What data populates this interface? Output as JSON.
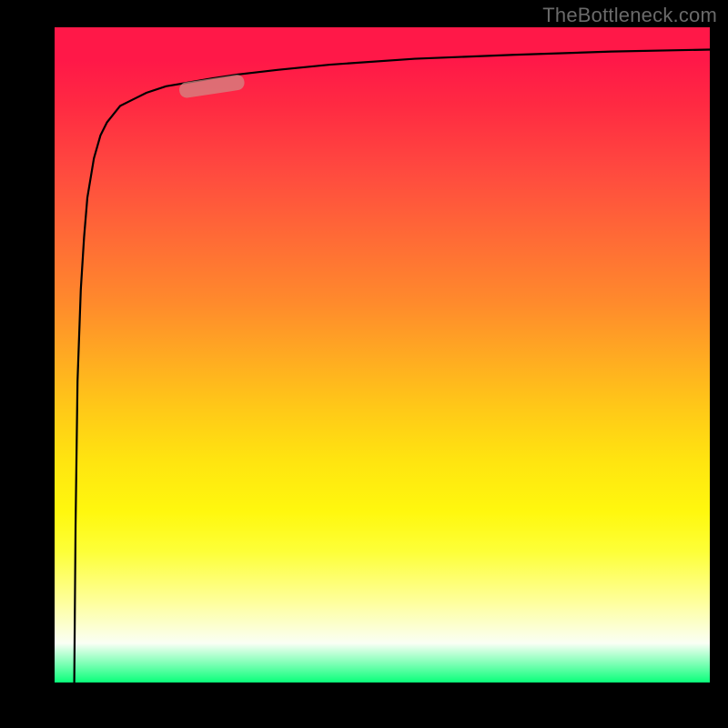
{
  "watermark": "TheBottleneck.com",
  "colors": {
    "background": "#000000",
    "gradient_top": "#ff1848",
    "gradient_mid": "#ffe410",
    "gradient_bottom": "#0aff7a",
    "curve": "#000000",
    "marker": "#d18a86"
  },
  "chart_data": {
    "type": "line",
    "title": "",
    "xlabel": "",
    "ylabel": "",
    "xlim": [
      0,
      100
    ],
    "ylim": [
      0,
      100
    ],
    "grid": false,
    "legend": false,
    "annotations": [
      {
        "kind": "segment-marker",
        "x_center": 24,
        "y_center": 91,
        "note": "highlighted portion of curve"
      }
    ],
    "series": [
      {
        "name": "curve",
        "x": [
          3,
          3.2,
          3.5,
          4,
          4.5,
          5,
          6,
          7,
          8,
          10,
          12,
          14,
          17,
          20,
          24,
          28,
          34,
          42,
          55,
          70,
          85,
          100
        ],
        "y": [
          0,
          24,
          46,
          60,
          68,
          74,
          80,
          83.5,
          85.5,
          88,
          89,
          90,
          91,
          91.5,
          92.2,
          92.8,
          93.5,
          94.3,
          95.2,
          95.8,
          96.3,
          96.6
        ]
      }
    ]
  }
}
